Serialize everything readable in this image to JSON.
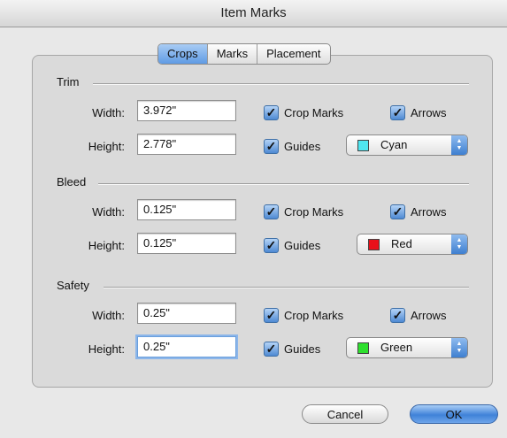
{
  "window": {
    "title": "Item Marks"
  },
  "tabs": [
    {
      "label": "Crops",
      "active": true
    },
    {
      "label": "Marks",
      "active": false
    },
    {
      "label": "Placement",
      "active": false
    }
  ],
  "sections": {
    "trim": {
      "label": "Trim",
      "width_label": "Width:",
      "width_value": "3.972\"",
      "height_label": "Height:",
      "height_value": "2.778\"",
      "crop_marks_label": "Crop Marks",
      "crop_marks_checked": true,
      "arrows_label": "Arrows",
      "arrows_checked": true,
      "guides_label": "Guides",
      "guides_checked": true,
      "color": {
        "label": "Cyan",
        "swatch": "#4fe6f0"
      }
    },
    "bleed": {
      "label": "Bleed",
      "width_label": "Width:",
      "width_value": "0.125\"",
      "height_label": "Height:",
      "height_value": "0.125\"",
      "crop_marks_label": "Crop Marks",
      "crop_marks_checked": true,
      "arrows_label": "Arrows",
      "arrows_checked": true,
      "guides_label": "Guides",
      "guides_checked": true,
      "color": {
        "label": "Red",
        "swatch": "#e8101a"
      }
    },
    "safety": {
      "label": "Safety",
      "width_label": "Width:",
      "width_value": "0.25\"",
      "height_label": "Height:",
      "height_value": "0.25\"",
      "crop_marks_label": "Crop Marks",
      "crop_marks_checked": true,
      "arrows_label": "Arrows",
      "arrows_checked": true,
      "guides_label": "Guides",
      "guides_checked": true,
      "color": {
        "label": "Green",
        "swatch": "#2ee02e"
      }
    }
  },
  "buttons": {
    "cancel": "Cancel",
    "ok": "OK"
  },
  "icons": {
    "checkbox": "checkmark-icon",
    "popup": "updown-arrows-icon"
  }
}
